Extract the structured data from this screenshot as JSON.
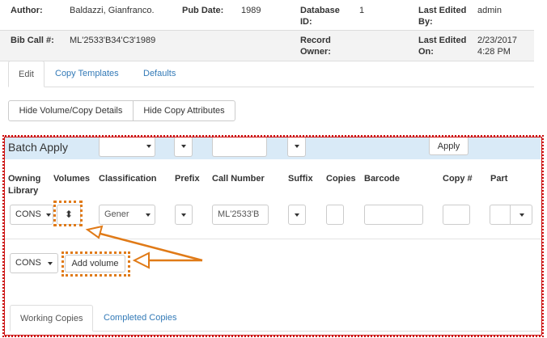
{
  "summary": {
    "row1": {
      "author_label": "Author:",
      "author_value": "Baldazzi, Gianfranco.",
      "pubdate_label": "Pub Date:",
      "pubdate_value": "1989",
      "dbid_label_1": "Database",
      "dbid_label_2": "ID:",
      "dbid_value": "1",
      "lastedited_by_label_1": "Last Edited",
      "lastedited_by_label_2": "By:",
      "lastedited_by_value": "admin"
    },
    "row2": {
      "bibcall_label": "Bib Call #:",
      "bibcall_value": "ML'2533'B34'C3'1989",
      "owner_label_1": "Record",
      "owner_label_2": "Owner:",
      "lastedited_on_label_1": "Last Edited",
      "lastedited_on_label_2": "On:",
      "lastedited_on_value_1": "2/23/2017",
      "lastedited_on_value_2": "4:28 PM"
    }
  },
  "tabs": [
    "Edit",
    "Copy Templates",
    "Defaults"
  ],
  "buttons": {
    "hide_volume": "Hide Volume/Copy Details",
    "hide_copy_attrs": "Hide Copy Attributes"
  },
  "batch": {
    "title": "Batch Apply",
    "apply_label": "Apply"
  },
  "headers": {
    "owning_1": "Owning",
    "owning_2": "Library",
    "volumes": "Volumes",
    "classification": "Classification",
    "prefix": "Prefix",
    "call_number": "Call Number",
    "suffix": "Suffix",
    "copies": "Copies",
    "barcode": "Barcode",
    "copy_num": "Copy #",
    "part": "Part"
  },
  "row": {
    "owning_library": "CONS",
    "volumes_stepper": "⬍",
    "classification": "Gener",
    "call_number": "ML'2533'B"
  },
  "add": {
    "library": "CONS",
    "add_volume_label": "Add volume"
  },
  "bottom_tabs": [
    "Working Copies",
    "Completed Copies"
  ],
  "colors": {
    "link": "#337ab7",
    "batch_bg": "#d9eaf7",
    "highlight_frame": "#cc1111",
    "annotation": "#e07a17"
  }
}
